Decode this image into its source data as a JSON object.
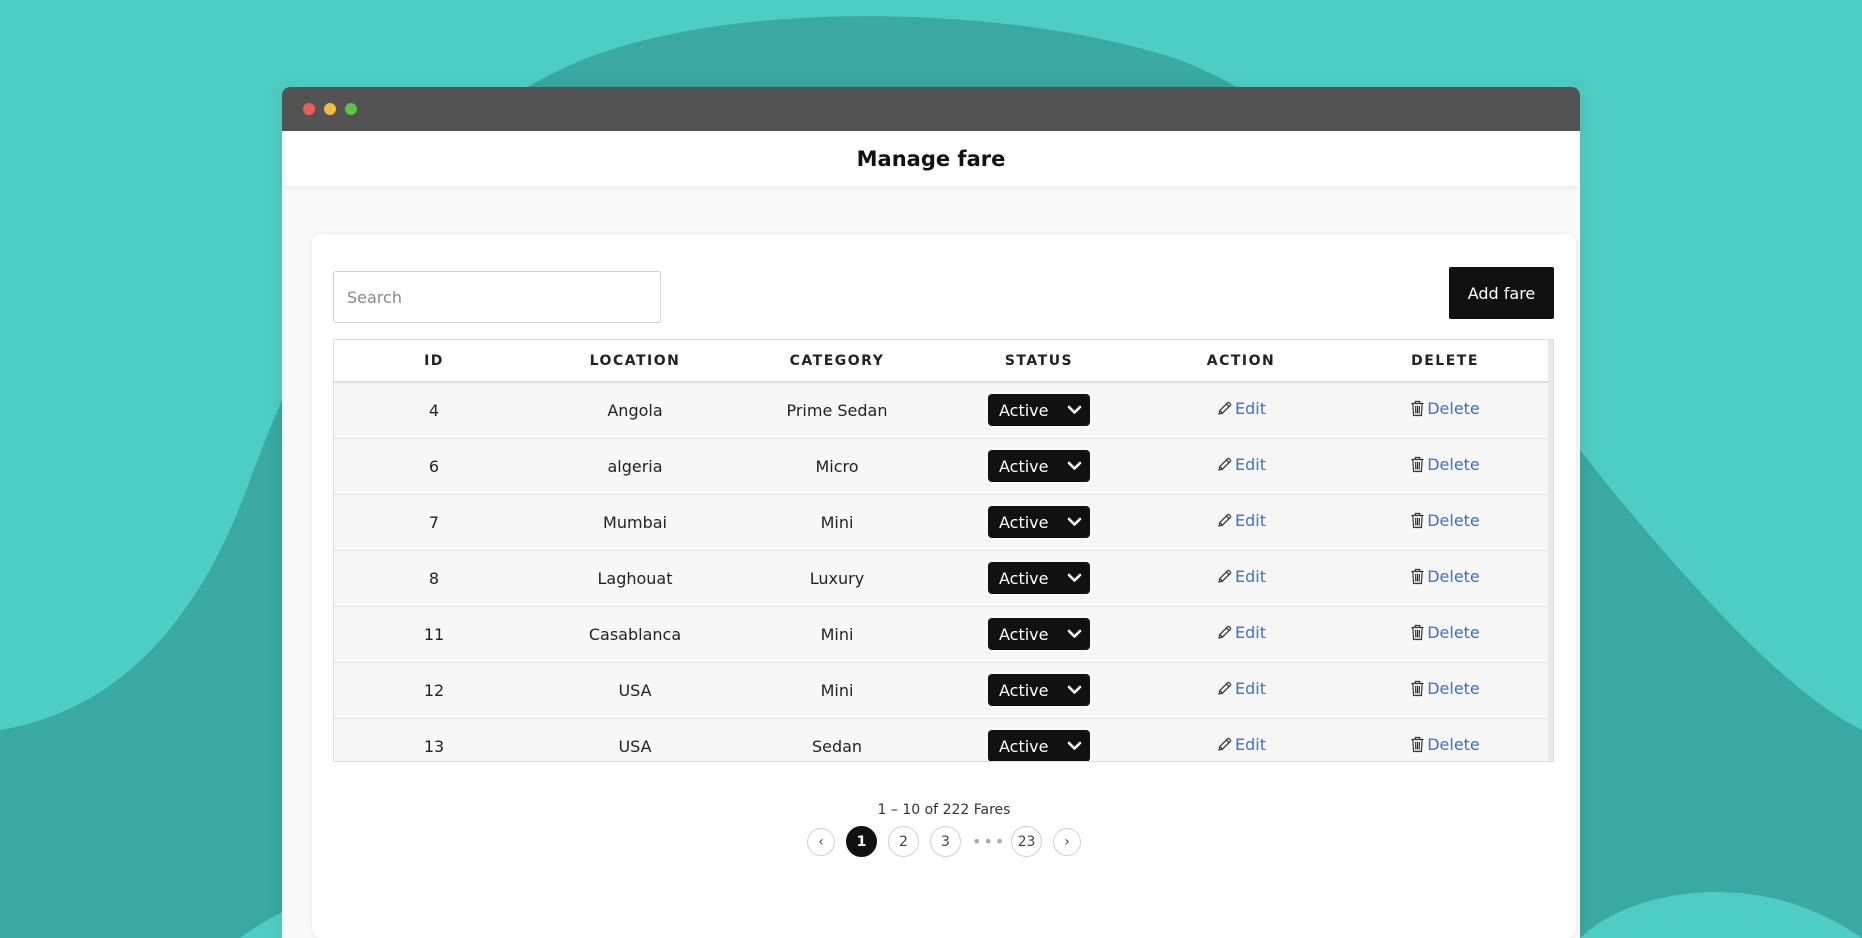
{
  "colors": {
    "background": "#4ecdc4",
    "background_shape": "#39a9a1",
    "titlebar": "#535353",
    "close_dot": "#ed5e57",
    "minimize_dot": "#f3bc3c",
    "maximize_dot": "#5cc549",
    "primary": "#111111",
    "link": "#3b6fd6"
  },
  "page": {
    "title": "Manage fare"
  },
  "toolbar": {
    "search_placeholder": "Search",
    "search_value": "",
    "add_label": "Add fare"
  },
  "table": {
    "columns": [
      "ID",
      "LOCATION",
      "CATEGORY",
      "STATUS",
      "ACTION",
      "DELETE"
    ],
    "edit_label": "Edit",
    "delete_label": "Delete",
    "edit_icon": "pencil-icon",
    "delete_icon": "trash-icon",
    "rows": [
      {
        "id": "4",
        "location": "Angola",
        "category": "Prime Sedan",
        "status": "Active"
      },
      {
        "id": "6",
        "location": "algeria",
        "category": "Micro",
        "status": "Active"
      },
      {
        "id": "7",
        "location": "Mumbai",
        "category": "Mini",
        "status": "Active"
      },
      {
        "id": "8",
        "location": "Laghouat",
        "category": "Luxury",
        "status": "Active"
      },
      {
        "id": "11",
        "location": "Casablanca",
        "category": "Mini",
        "status": "Active"
      },
      {
        "id": "12",
        "location": "USA",
        "category": "Mini",
        "status": "Active"
      },
      {
        "id": "13",
        "location": "USA",
        "category": "Sedan",
        "status": "Active"
      }
    ]
  },
  "pagination": {
    "summary": "1 – 10 of 222 Fares",
    "prev": "‹",
    "next": "›",
    "pages": [
      "1",
      "2",
      "3"
    ],
    "ellipsis": "•••",
    "last": "23",
    "current": "1"
  }
}
